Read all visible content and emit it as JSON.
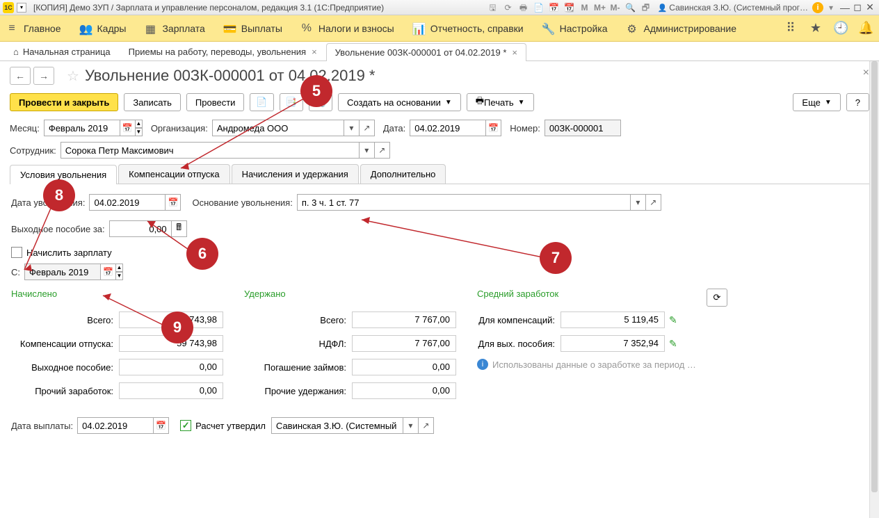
{
  "titlebar": {
    "title": "[КОПИЯ] Демо ЗУП / Зарплата и управление персоналом, редакция 3.1  (1С:Предприятие)",
    "user": "Савинская З.Ю. (Системный прог…",
    "m": "M",
    "mplus": "M+",
    "mminus": "M-"
  },
  "mainmenu": {
    "items": [
      {
        "icon": "≡",
        "label": "Главное"
      },
      {
        "icon": "👥",
        "label": "Кадры"
      },
      {
        "icon": "▦",
        "label": "Зарплата"
      },
      {
        "icon": "💳",
        "label": "Выплаты"
      },
      {
        "icon": "%",
        "label": "Налоги и взносы"
      },
      {
        "icon": "📊",
        "label": "Отчетность, справки"
      },
      {
        "icon": "🔧",
        "label": "Настройка"
      },
      {
        "icon": "⚙",
        "label": "Администрирование"
      }
    ]
  },
  "tabs": {
    "home": "Начальная страница",
    "t1": "Приемы на работу, переводы, увольнения",
    "t2": "Увольнение 00ЗК-000001 от 04.02.2019 *"
  },
  "page": {
    "title": "Увольнение 00ЗК-000001 от 04.02.2019 *"
  },
  "cmd": {
    "post_close": "Провести и закрыть",
    "save": "Записать",
    "post": "Провести",
    "create_based": "Создать на основании",
    "print": "Печать",
    "more": "Еще",
    "help": "?"
  },
  "form": {
    "month_label": "Месяц:",
    "month": "Февраль 2019",
    "org_label": "Организация:",
    "org": "Андромеда ООО",
    "date_label": "Дата:",
    "date": "04.02.2019",
    "num_label": "Номер:",
    "num": "00ЗК-000001",
    "emp_label": "Сотрудник:",
    "emp": "Сорока Петр Максимович"
  },
  "subtabs": {
    "t0": "Условия увольнения",
    "t1": "Компенсации отпуска",
    "t2": "Начисления и удержания",
    "t3": "Дополнительно"
  },
  "dismiss": {
    "date_label": "Дата увольнения:",
    "date": "04.02.2019",
    "reason_label": "Основание увольнения:",
    "reason": "п. 3 ч. 1 ст. 77",
    "sev_label": "Выходное пособие за:",
    "sev": "0,00",
    "calc_salary": "Начислить зарплату",
    "from_label": "С:",
    "from": "Февраль 2019"
  },
  "totals": {
    "accrued": "Начислено",
    "withheld": "Удержано",
    "avg": "Средний заработок",
    "all_label": "Всего:",
    "all_a": "59 743,98",
    "all_w": "7 767,00",
    "comp_label": "Компенсации отпуска:",
    "comp": "59 743,98",
    "ndfl_label": "НДФЛ:",
    "ndfl": "7 767,00",
    "sev_label": "Выходное пособие:",
    "sev": "0,00",
    "loan_label": "Погашение займов:",
    "loan": "0,00",
    "other_a_label": "Прочий заработок:",
    "other_a": "0,00",
    "other_w_label": "Прочие удержания:",
    "other_w": "0,00",
    "for_comp_label": "Для компенсаций:",
    "for_comp": "5 119,45",
    "for_sev_label": "Для вых. пособия:",
    "for_sev": "7 352,94",
    "note": "Использованы данные о заработке за период …"
  },
  "footer": {
    "paydate_label": "Дата выплаты:",
    "paydate": "04.02.2019",
    "approved_label": "Расчет утвердил",
    "approved_by": "Савинская З.Ю. (Системный п"
  },
  "anno": {
    "n5": "5",
    "n6": "6",
    "n7": "7",
    "n8": "8",
    "n9": "9"
  }
}
